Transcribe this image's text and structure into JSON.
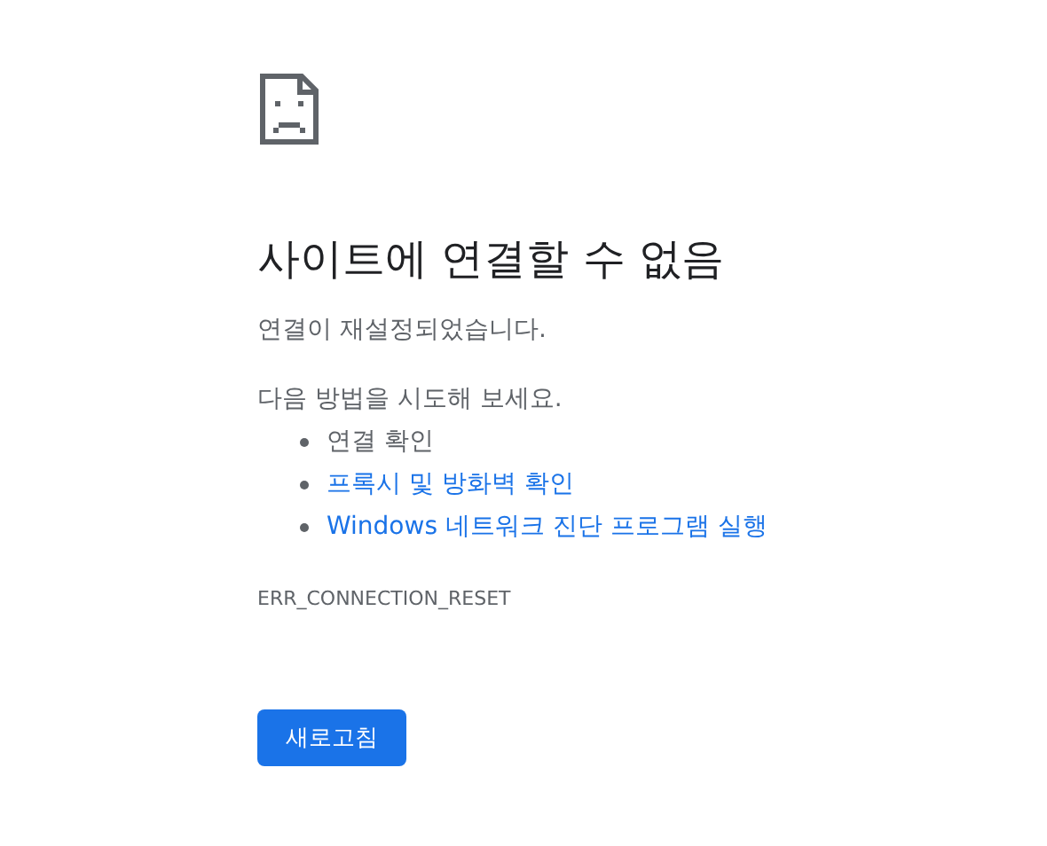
{
  "heading": "사이트에 연결할 수 없음",
  "message": "연결이 재설정되었습니다.",
  "suggestions_intro": "다음 방법을 시도해 보세요.",
  "suggestions": [
    {
      "kind": "text",
      "label": "연결 확인"
    },
    {
      "kind": "link",
      "label": "프록시 및 방화벽 확인"
    },
    {
      "kind": "link",
      "label": "Windows 네트워크 진단 프로그램 실행"
    }
  ],
  "error_code": "ERR_CONNECTION_RESET",
  "reload_button": "새로고침"
}
